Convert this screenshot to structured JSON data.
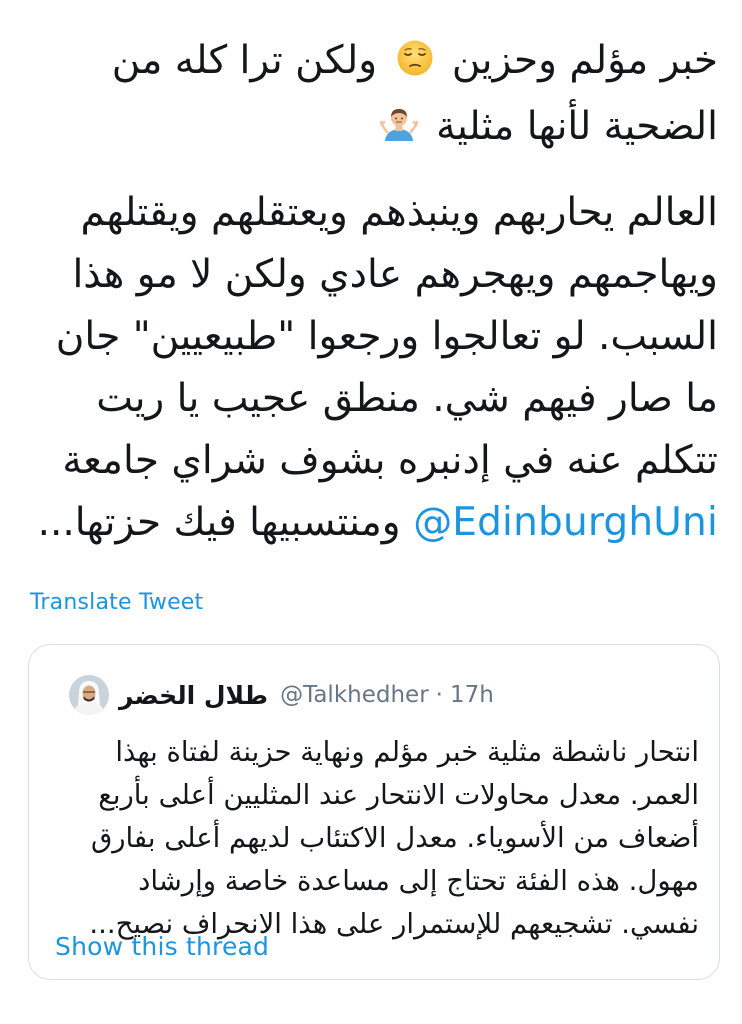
{
  "tweet": {
    "line_1": "خبر مؤلم وحزين",
    "line_1_tail": "ولكن ترا كله من",
    "line_2": "الضحية لأنها مثلية",
    "body_line_1": "العالم يحاربهم وينبذهم ويعتقلهم ويقتلهم",
    "body_line_2": "ويهاجمهم ويهجرهم عادي ولكن لا مو هذا",
    "body_line_3": "السبب. لو تعالجوا ورجعوا \"طبيعيين\" جان",
    "body_line_4": "ما صار فيهم شي. منطق عجيب يا ريت",
    "body_line_5": "تتكلم عنه في إدنبره بشوف شراي جامعة",
    "body_line_6_tail": "ومنتسبيها فيك حزتها...",
    "mention": "@EdinburghUni",
    "emoji": {
      "pensive": "pensive-face-icon",
      "shrug": "person-shrugging-icon"
    }
  },
  "translate_label": "Translate Tweet",
  "quoted_tweet": {
    "author_name": "طلال الخضر",
    "handle": "@Talkhedher",
    "separator": "·",
    "time": "17h",
    "line_1": "انتحار ناشطة مثلية خبر مؤلم ونهاية حزينة لفتاة بهذا",
    "line_2": "العمر. معدل محاولات الانتحار عند المثليين أعلى بأربع",
    "line_3": "أضعاف من الأسوياء. معدل الاكتئاب لديهم أعلى بفارق",
    "line_4": "مهول. هذه الفئة تحتاج إلى مساعدة خاصة وإرشاد",
    "line_5": "نفسي. تشجيعهم للإستمرار على هذا الانحراف نصيح...",
    "show_thread_label": "Show this thread"
  },
  "colors": {
    "link": "#1b95e0",
    "text": "#14171a",
    "secondary": "#657786",
    "border": "#d7dde2"
  }
}
